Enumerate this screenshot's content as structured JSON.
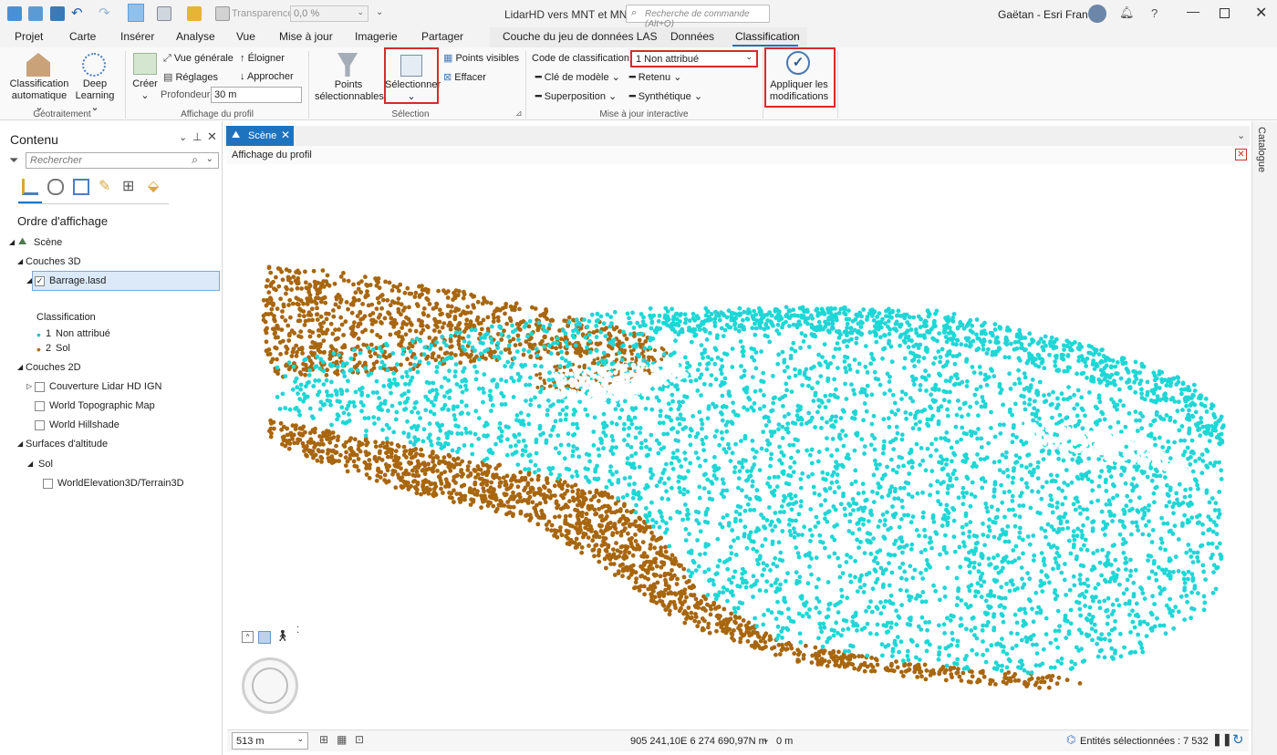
{
  "window": {
    "title": "LidarHD vers MNT et MNS",
    "command_search_placeholder": "Recherche de commande (Alt+Q)",
    "user": "Gaëtan - Esri France",
    "transparency_label": "Transparence",
    "transparency_value": "0,0 %"
  },
  "tabs": {
    "main": [
      "Projet",
      "Carte",
      "Insérer",
      "Analyse",
      "Vue",
      "Mise à jour",
      "Imagerie",
      "Partager"
    ],
    "contextual": [
      "Couche du jeu de données LAS",
      "Données",
      "Classification"
    ],
    "active": "Classification"
  },
  "ribbon": {
    "geotraitement": {
      "label": "Géotraitement",
      "auto_class_line1": "Classification",
      "auto_class_line2": "automatique",
      "deep_line1": "Deep",
      "deep_line2": "Learning"
    },
    "profile": {
      "label": "Affichage du profil",
      "create": "Créer",
      "overview": "Vue générale",
      "settings": "Réglages",
      "move_away": "Éloigner",
      "approach": "Approcher",
      "depth_label": "Profondeur",
      "depth_value": "30 m"
    },
    "selection": {
      "label": "Sélection",
      "points_line1": "Points",
      "points_line2": "sélectionnables",
      "select": "Sélectionner",
      "visible_points": "Points visibles",
      "clear": "Effacer"
    },
    "interactive": {
      "label": "Mise à jour interactive",
      "class_code_label": "Code de classification",
      "class_code_value": "1 Non attribué",
      "model_key": "Clé de modèle",
      "withheld": "Retenu",
      "overlap": "Superposition",
      "synthetic": "Synthétique"
    },
    "apply": {
      "line1": "Appliquer les",
      "line2": "modifications"
    }
  },
  "contents": {
    "title": "Contenu",
    "search_placeholder": "Rechercher",
    "drawing_order": "Ordre d'affichage",
    "scene": "Scène",
    "layers_3d": "Couches 3D",
    "las_layer": "Barrage.lasd",
    "classification_heading": "Classification",
    "class_items": [
      {
        "code": "1",
        "label": "Non attribué",
        "color": "#1fc6c6"
      },
      {
        "code": "2",
        "label": "Sol",
        "color": "#b06b10"
      }
    ],
    "layers_2d": "Couches 2D",
    "layers_2d_items": [
      "Couverture Lidar HD IGN",
      "World Topographic Map",
      "World Hillshade"
    ],
    "elevation_surfaces": "Surfaces d'altitude",
    "ground": "Sol",
    "terrain": "WorldElevation3D/Terrain3D"
  },
  "view": {
    "tab": "Scène",
    "profile_caption": "Affichage du profil",
    "scale": "513 m",
    "coordinates": "905 241,10E 6 274 690,97N m",
    "elevation": "0 m",
    "selected_count": "Entités sélectionnées : 7 532",
    "catalog": "Catalogue"
  },
  "colors": {
    "unclassified": "#1fd6d6",
    "ground": "#a8660e",
    "accent": "#1e73be",
    "highlight": "#d62b2b"
  }
}
